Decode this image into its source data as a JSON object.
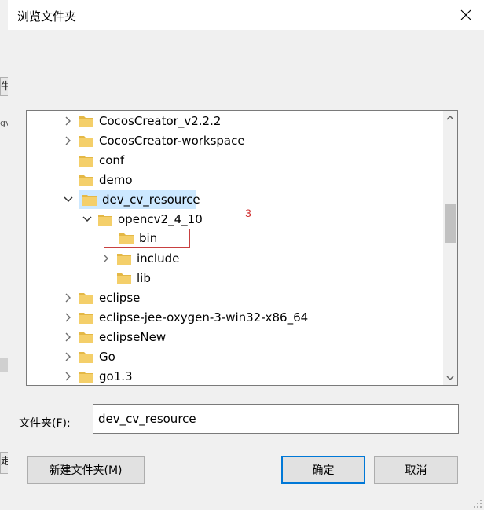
{
  "dialog": {
    "title": "浏览文件夹",
    "folder_label": "文件夹(F):",
    "folder_value": "dev_cv_resource",
    "new_folder_label": "新建文件夹(M)",
    "ok_label": "确定",
    "cancel_label": "取消"
  },
  "background": {
    "fragment_top": "牛",
    "fragment_mid": "gv",
    "fragment_bottom": "走"
  },
  "annotation": "3",
  "tree": {
    "items": [
      {
        "label": "CocosCreator_v2.2.2",
        "expander": "collapsed",
        "depth": 0
      },
      {
        "label": "CocosCreator-workspace",
        "expander": "collapsed",
        "depth": 0
      },
      {
        "label": "conf",
        "expander": "none",
        "depth": 0
      },
      {
        "label": "demo",
        "expander": "none",
        "depth": 0
      },
      {
        "label": "dev_cv_resource",
        "expander": "expanded",
        "depth": 0,
        "selected": true
      },
      {
        "label": "opencv2_4_10",
        "expander": "expanded",
        "depth": 1
      },
      {
        "label": "bin",
        "expander": "none",
        "depth": 2,
        "boxed": true
      },
      {
        "label": "include",
        "expander": "collapsed",
        "depth": 2
      },
      {
        "label": "lib",
        "expander": "none",
        "depth": 2
      },
      {
        "label": "eclipse",
        "expander": "collapsed",
        "depth": 0
      },
      {
        "label": "eclipse-jee-oxygen-3-win32-x86_64",
        "expander": "collapsed",
        "depth": 0
      },
      {
        "label": "eclipseNew",
        "expander": "collapsed",
        "depth": 0
      },
      {
        "label": "Go",
        "expander": "collapsed",
        "depth": 0
      },
      {
        "label": "go1.3",
        "expander": "collapsed",
        "depth": 0
      }
    ],
    "scroll_position": 0.38
  },
  "colors": {
    "selection": "#cce8ff",
    "folder": "#f4cf6a",
    "folder_dark": "#e4b846",
    "accent": "#0078d7",
    "annotation": "#d03030"
  }
}
